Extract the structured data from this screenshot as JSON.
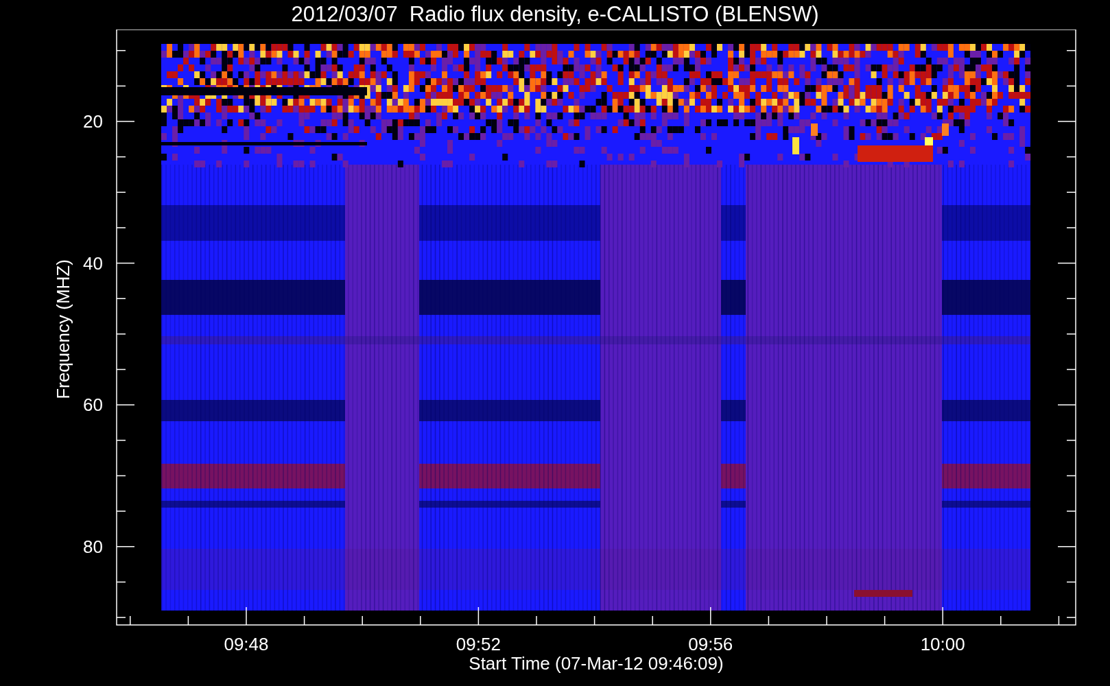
{
  "title": "2012/03/07  Radio flux density, e-CALLISTO (BLENSW)",
  "y_axis": {
    "label": "Frequency (MHZ)",
    "ticks": [
      "20",
      "40",
      "60",
      "80"
    ]
  },
  "x_axis": {
    "label": "Start Time (07-Mar-12 09:46:09)",
    "ticks": [
      "09:48",
      "09:52",
      "09:56",
      "10:00"
    ]
  }
}
